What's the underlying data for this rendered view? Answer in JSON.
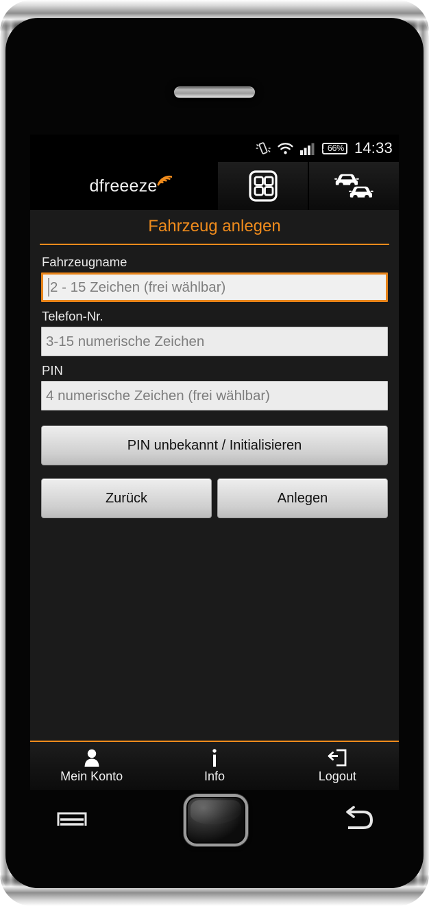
{
  "status_bar": {
    "vibrate_icon": "vibrate-icon",
    "wifi_icon": "wifi-icon",
    "signal_icon": "signal-bars-icon",
    "battery_icon": "battery-icon",
    "battery_level": "66%",
    "clock": "14:33"
  },
  "header": {
    "brand": "dfreeeze",
    "brand_wave_icon": "signal-wave-icon",
    "brand_accent_color": "#ef8b1c",
    "tabs": [
      {
        "name": "grid-menu",
        "icon": "grid-menu-icon",
        "label": ""
      },
      {
        "name": "vehicles",
        "icon": "two-cars-icon",
        "label": ""
      }
    ]
  },
  "page": {
    "title": "Fahrzeug anlegen",
    "title_color": "#ef8b1c",
    "accent_color": "#ef8b1c"
  },
  "form": {
    "fields": [
      {
        "label": "Fahrzeugname",
        "placeholder": "2 - 15 Zeichen (frei wählbar)",
        "value": "",
        "focused": true
      },
      {
        "label": "Telefon-Nr.",
        "placeholder": "3-15 numerische Zeichen",
        "value": "",
        "focused": false
      },
      {
        "label": "PIN",
        "placeholder": "4 numerische Zeichen (frei wählbar)",
        "value": "",
        "focused": false
      }
    ],
    "pin_unknown_button": "PIN unbekannt / Initialisieren",
    "back_button": "Zurück",
    "create_button": "Anlegen"
  },
  "bottom_nav": [
    {
      "label": "Mein Konto",
      "icon": "person-icon"
    },
    {
      "label": "Info",
      "icon": "info-icon"
    },
    {
      "label": "Logout",
      "icon": "logout-icon"
    }
  ],
  "hardware_buttons": [
    {
      "name": "menu-button",
      "icon": "menu-icon"
    },
    {
      "name": "home-button",
      "icon": "home-button-icon"
    },
    {
      "name": "back-button",
      "icon": "back-arrow-icon"
    }
  ]
}
